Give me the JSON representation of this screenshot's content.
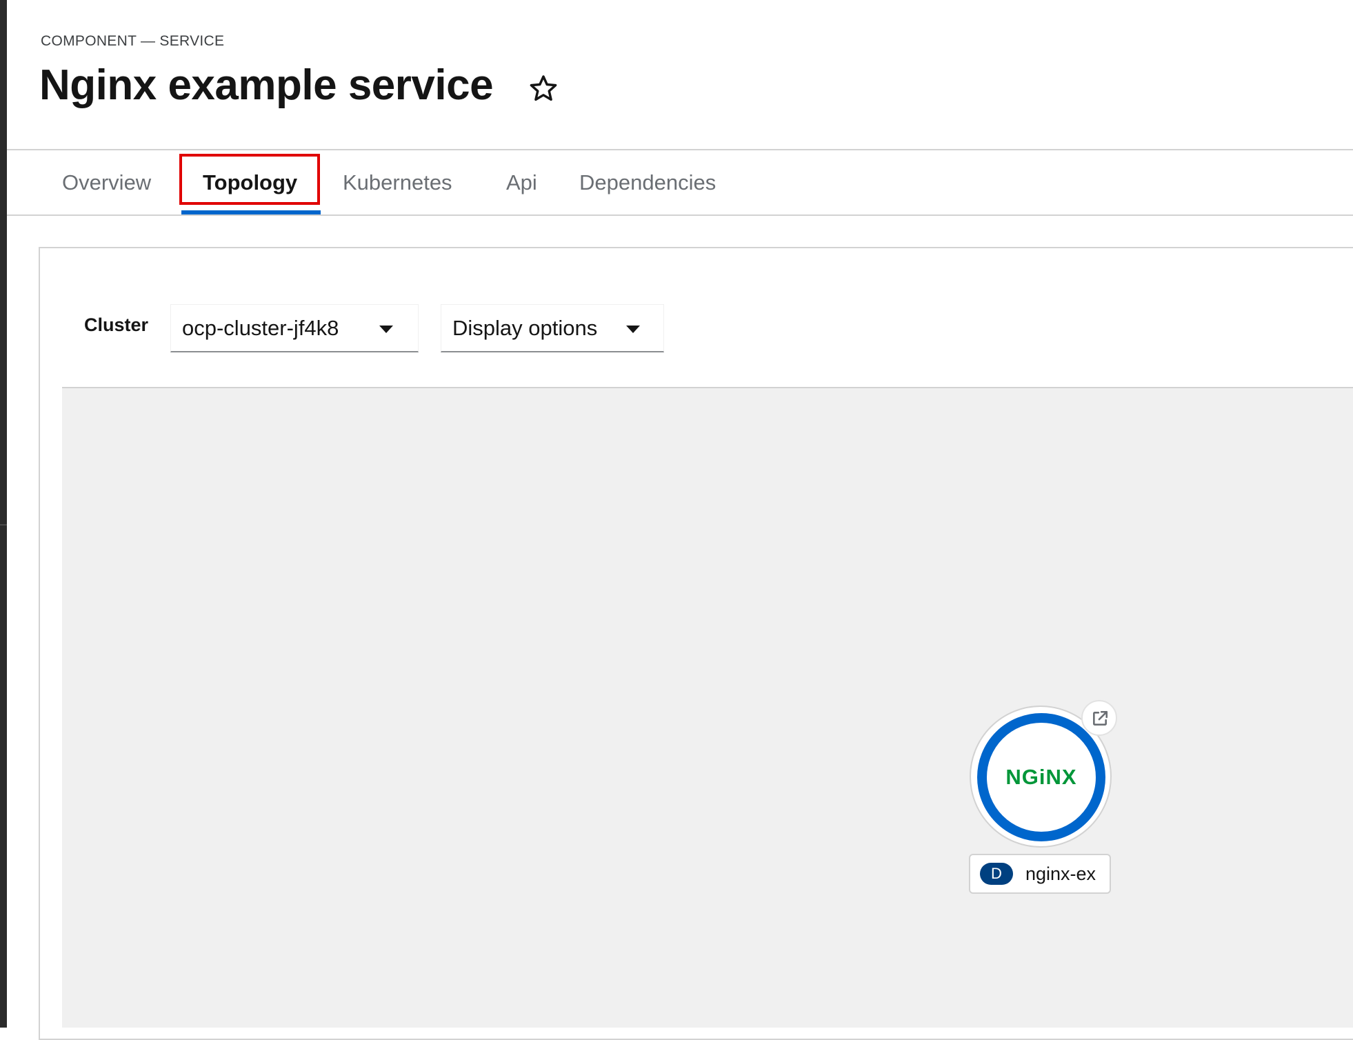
{
  "header": {
    "breadcrumb": "COMPONENT — SERVICE",
    "title": "Nginx example service"
  },
  "tabs": [
    {
      "label": "Overview",
      "active": false
    },
    {
      "label": "Topology",
      "active": true
    },
    {
      "label": "Kubernetes",
      "active": false
    },
    {
      "label": "Api",
      "active": false
    },
    {
      "label": "Dependencies",
      "active": false
    }
  ],
  "toolbar": {
    "cluster_label": "Cluster",
    "cluster_value": "ocp-cluster-jf4k8",
    "display_options_label": "Display options"
  },
  "topology": {
    "node": {
      "logo_text": "NGiNX",
      "kind_badge": "D",
      "name": "nginx-ex"
    }
  },
  "colors": {
    "accent": "#0066cc",
    "highlight": "#e00000",
    "nginx_green": "#009639",
    "kind_badge": "#004080",
    "canvas_bg": "#f0f0f0"
  },
  "icons": {
    "favorite": "star-icon",
    "dropdown": "caret-down-icon",
    "open_url": "external-link-icon"
  }
}
